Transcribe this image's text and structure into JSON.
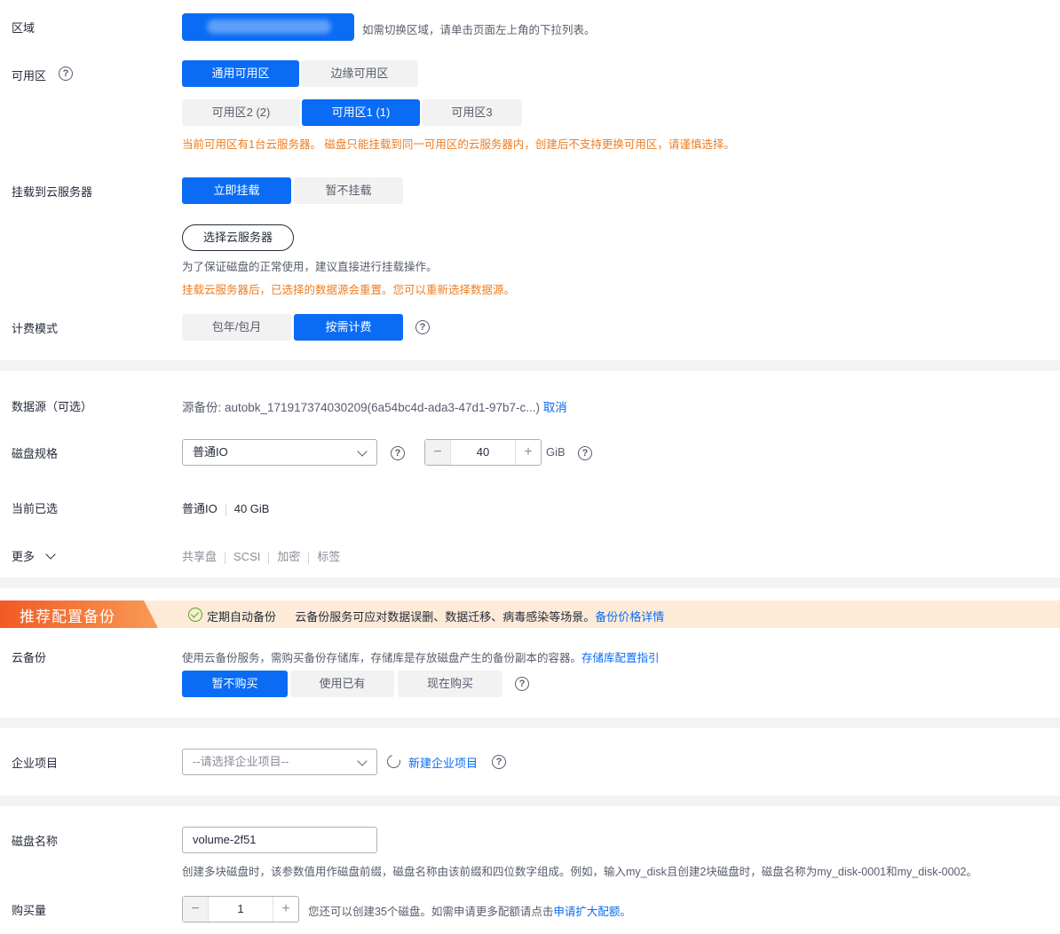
{
  "region": {
    "label": "区域",
    "hint": "如需切换区域，请单击页面左上角的下拉列表。"
  },
  "az": {
    "label": "可用区",
    "help": "?",
    "types": [
      "通用可用区",
      "边缘可用区"
    ],
    "zones": [
      "可用区2 (2)",
      "可用区1 (1)",
      "可用区3"
    ],
    "warning": "当前可用区有1台云服务器。 磁盘只能挂载到同一可用区的云服务器内，创建后不支持更换可用区，请谨慎选择。"
  },
  "attach": {
    "label": "挂载到云服务器",
    "options": [
      "立即挂载",
      "暂不挂载"
    ],
    "select_button": "选择云服务器",
    "hint": "为了保证磁盘的正常使用，建议直接进行挂载操作。",
    "warning": "挂载云服务器后，已选择的数据源会重置。您可以重新选择数据源。"
  },
  "billing": {
    "label": "计费模式",
    "options": [
      "包年/包月",
      "按需计费"
    ],
    "help": "?"
  },
  "datasource": {
    "label": "数据源（可选）",
    "value": "源备份: autobk_171917374030209(6a54bc4d-ada3-47d1-97b7-c...)",
    "cancel": "取消"
  },
  "disk_spec": {
    "label": "磁盘规格",
    "type": "普通IO",
    "size": "40",
    "unit": "GiB",
    "minus": "−",
    "plus": "+",
    "help": "?"
  },
  "current": {
    "label": "当前已选",
    "type": "普通IO",
    "size": "40 GiB"
  },
  "more": {
    "label": "更多",
    "tags": [
      "共享盘",
      "SCSI",
      "加密",
      "标签"
    ]
  },
  "banner": {
    "badge": "推荐配置备份",
    "check_label": "定期自动备份",
    "text": "云备份服务可应对数据误删、数据迁移、病毒感染等场景。",
    "link": "备份价格详情"
  },
  "backup": {
    "label": "云备份",
    "desc": "使用云备份服务，需购买备份存储库，存储库是存放磁盘产生的备份副本的容器。",
    "desc_link": "存储库配置指引",
    "options": [
      "暂不购买",
      "使用已有",
      "现在购买"
    ],
    "help": "?"
  },
  "enterprise": {
    "label": "企业项目",
    "placeholder": "--请选择企业项目--",
    "new_link": "新建企业项目",
    "help": "?"
  },
  "disk_name": {
    "label": "磁盘名称",
    "value": "volume-2f51",
    "hint": "创建多块磁盘时，该参数值用作磁盘前缀，磁盘名称由该前缀和四位数字组成。例如，输入my_disk且创建2块磁盘时，磁盘名称为my_disk-0001和my_disk-0002。"
  },
  "quantity": {
    "label": "购买量",
    "value": "1",
    "minus": "−",
    "plus": "+",
    "hint": "您还可以创建35个磁盘。如需申请更多配额请点击",
    "link": "申请扩大配额",
    "end": "。"
  },
  "colors": {
    "primary": "#0a6cf5",
    "warning": "#ed7d22",
    "banner_bg": "#fdebd8",
    "success": "#50a31e"
  }
}
